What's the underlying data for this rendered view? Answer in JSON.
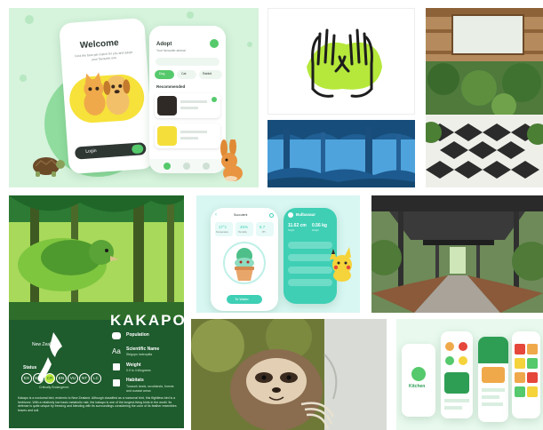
{
  "pet_app": {
    "welcome_title": "Welcome",
    "welcome_subtitle": "Find the best pet match for you and adopt your favourite one",
    "login_label": "Login",
    "adopt_title": "Adopt",
    "adopt_subtitle": "Your favourite animal",
    "categories": [
      "Dog",
      "Cat",
      "Rabbit"
    ],
    "recommended_label": "Recommended"
  },
  "plant_app": {
    "header_title": "Succulent",
    "stat_values": [
      "17°c",
      "45%",
      "6.7"
    ],
    "stat_labels": [
      "Temperature",
      "Humidity",
      "PH"
    ],
    "detail_title": "Bulbasaur",
    "detail_value_1": "11.62 cm",
    "detail_value_2": "0.56 kg",
    "detail_label_1": "Height",
    "detail_label_2": "Weight",
    "cta_label": "To Water"
  },
  "kakapo_poster": {
    "title": "KAKAPO",
    "region": "New Zealand",
    "population_label": "Population",
    "sci_label": "Scientific Name",
    "sci_value": "Strigops habroptila",
    "weight_label": "Weight",
    "weight_value": "0.9 to 4 kilograms",
    "habitats_label": "Habitats",
    "habitats_value": "Tussock lands, scrublands, forests and coastal areas",
    "status_label": "Status",
    "status_codes": [
      "EX",
      "EW",
      "CR",
      "EN",
      "VU",
      "NT",
      "LC"
    ],
    "critically_label": "Critically Endangered",
    "aa_glyph": "Aa",
    "description": "Kakapo is a nocturnal bird, endemic to New Zealand. Although classified as a nocturnal bird, this flightless bird is a herbivore. With a relatively low basic metabolic rate, the kakapo is one of the longest-living birds in the world. Its defense is quite unique by freezing and blending with its surroundings considering the color of its feather resembles leaves and soil."
  },
  "kitchen_app": {
    "brand": "Kitchen"
  },
  "colors": {
    "mint_bg": "#d9f5de",
    "mint_green": "#55c96b",
    "kakapo_bg": "#1e5b2d",
    "teal": "#3fcfb5",
    "cta_green": "#3ab36f",
    "hands_green": "#b5e83a"
  }
}
